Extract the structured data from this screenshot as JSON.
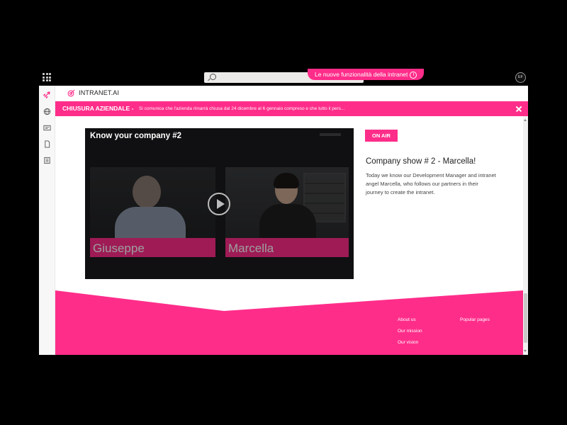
{
  "topbar": {
    "new_features": "Le nuove funzionalità della intranet",
    "new_features_icon": "info-icon",
    "avatar_initials": "EF"
  },
  "app": {
    "brand": "INTRANET.AI",
    "accent_color": "#ff2d8a",
    "rail_icons": [
      "rocket-icon",
      "globe-icon",
      "news-icon",
      "document-icon",
      "book-icon"
    ]
  },
  "banner": {
    "title": "CHIUSURA AZIENDALE -",
    "message": "Si comunica che l'azienda rimarrà chiusa dal 24 dicembre al 6 gennaio compreso e che tutto il pers..."
  },
  "video": {
    "title": "Know your company #2",
    "person_left": "Giuseppe",
    "person_right": "Marcella"
  },
  "show": {
    "badge": "ON AIR",
    "title": "Company show # 2 - Marcella!",
    "description": "Today we know our Development Manager and intranet angel Marcella, who follows our partners in their journey to create the intranet."
  },
  "footer": {
    "col1": [
      "About us",
      "Our mission",
      "Our vision"
    ],
    "col2": [
      "Popular pages"
    ]
  }
}
